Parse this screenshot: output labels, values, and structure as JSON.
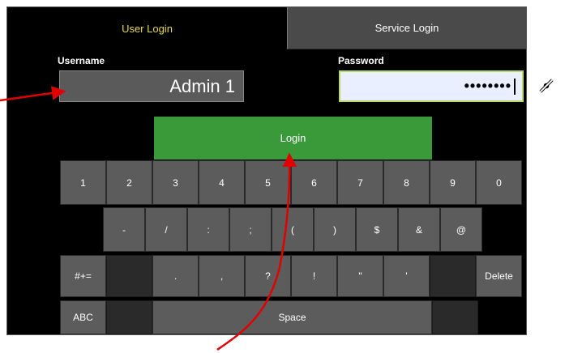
{
  "tabs": {
    "user_login": "User Login",
    "service_login": "Service Login"
  },
  "form": {
    "username_label": "Username",
    "username_value": "Admin 1",
    "password_label": "Password",
    "password_mask": "••••••••",
    "login_label": "Login"
  },
  "icons": {
    "visibility_toggle": "eye-slash-icon"
  },
  "keyboard": {
    "row1": [
      "1",
      "2",
      "3",
      "4",
      "5",
      "6",
      "7",
      "8",
      "9",
      "0"
    ],
    "row2": [
      "-",
      "/",
      ":",
      ";",
      "(",
      ")",
      "$",
      "&",
      "@"
    ],
    "row3": [
      "#+=",
      "",
      ".",
      ",",
      "?",
      "!",
      "\"",
      "'",
      "",
      "Delete"
    ],
    "row4": [
      "ABC",
      "",
      "Space",
      ""
    ]
  },
  "colors": {
    "active_tab_text": "#e6d84a",
    "login_button": "#3a9a3a",
    "annotation_arrow": "#e00000",
    "password_focus_border": "#b6d96d"
  }
}
